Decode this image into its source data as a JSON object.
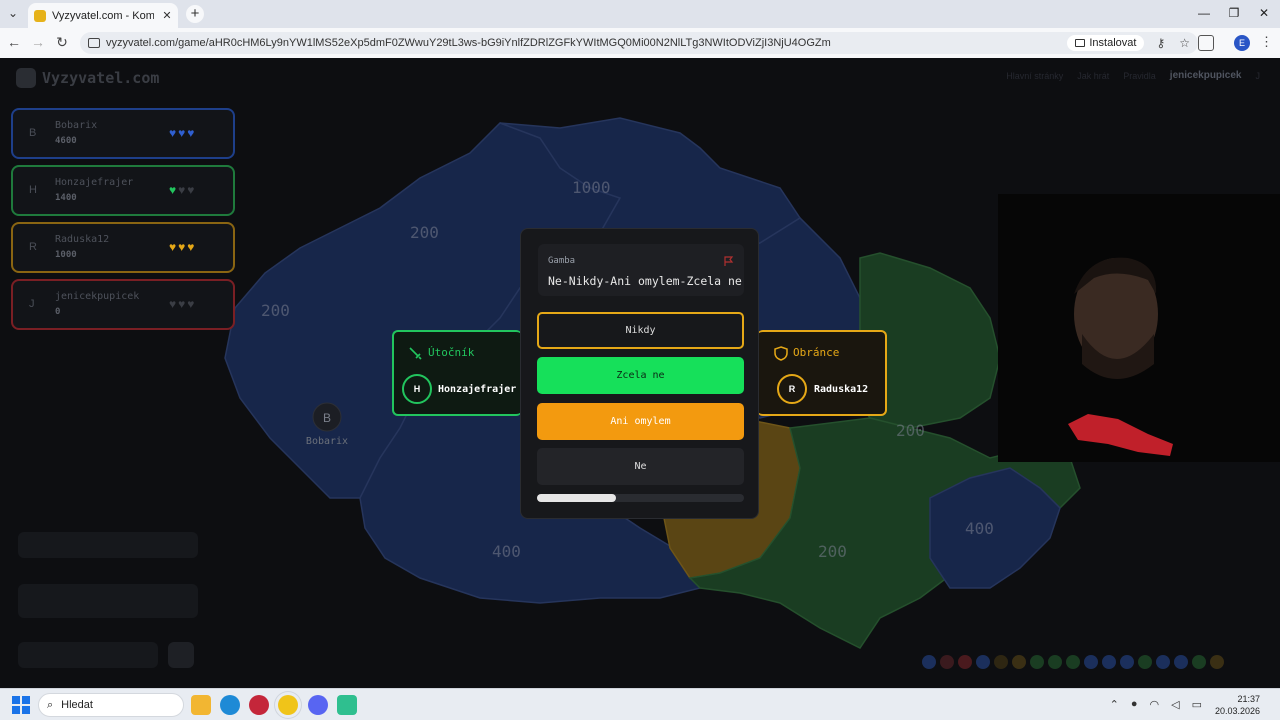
{
  "browser": {
    "tab_title": "Vyzyvatel.com - Komunitní vědomostní hra",
    "url": "vyzyvatel.com/game/aHR0cHM6Ly9nYW1lMS52eXp5dmF0ZWwuY29tL3ws-bG9iYnlfZDRlZGFkYWItMGQ0Mi00N2NlLTg3NWItODViZjI3NjU4OGZm",
    "install_label": "Instalovat",
    "profile_initial": "E"
  },
  "header": {
    "logo": "Vyzyvatel.com",
    "nav": [
      "Hlavní stránky",
      "Jak hrát",
      "Pravidla"
    ],
    "username": "jenicekpupicek",
    "user_initial": "J"
  },
  "players": [
    {
      "initial": "B",
      "name": "Bobarix",
      "score": "4600",
      "border": "#1e3f8a",
      "heart_color": "#2f5fd0"
    },
    {
      "initial": "H",
      "name": "Honzajefrajer",
      "score": "1400",
      "border": "#1f7a3c",
      "heart_color": "#22c55e"
    },
    {
      "initial": "R",
      "name": "Raduska12",
      "score": "1000",
      "border": "#8a6512",
      "heart_color": "#e5a817"
    },
    {
      "initial": "J",
      "name": "jenicekpupicek",
      "score": "0",
      "border": "#7a1f24",
      "heart_color": "#444"
    }
  ],
  "map": {
    "labels": [
      "1000",
      "200",
      "200",
      "200",
      "400",
      "200",
      "400",
      "200"
    ],
    "marker_initial": "B",
    "marker_name": "Bobarix"
  },
  "attacker": {
    "role": "Útočník",
    "initial": "H",
    "name": "Honzajefrajer"
  },
  "defender": {
    "role": "Obránce",
    "initial": "R",
    "name": "Raduska12"
  },
  "question": {
    "category": "Gamba",
    "text": "Ne-Nikdy-Ani omylem-Zcela ne",
    "answers": [
      "Nikdy",
      "Zcela ne",
      "Ani omylem",
      "Ne"
    ],
    "progress": 0.38
  },
  "taskbar": {
    "search_label": "Hledat",
    "time": "21:37",
    "date": "20.03.2026"
  }
}
